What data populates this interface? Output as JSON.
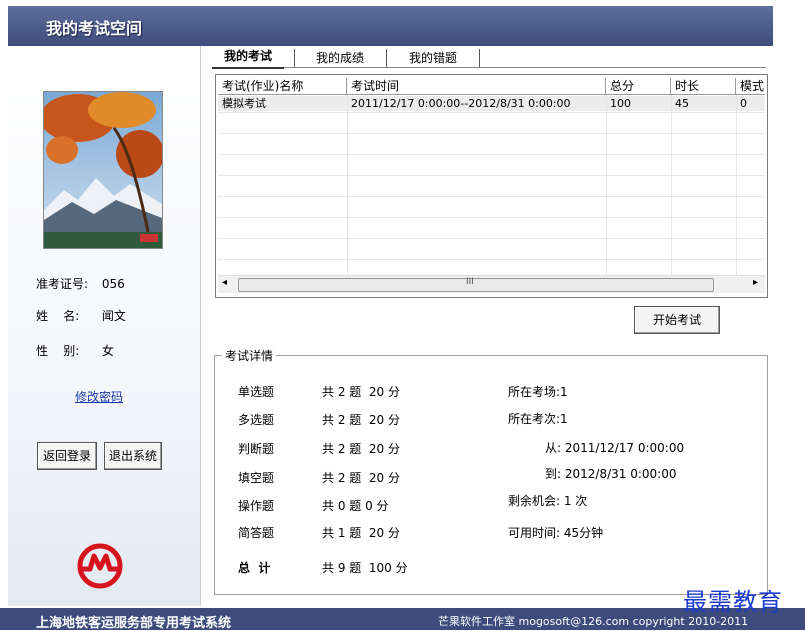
{
  "window": {
    "title": "我的考试空间"
  },
  "profile": {
    "id_label": "准考证号:",
    "id_value": "056",
    "name_label": "姓    名:",
    "name_value": "闻文",
    "gender_label": "性    别:",
    "gender_value": "女",
    "change_password": "修改密码",
    "back_login": "返回登录",
    "exit_system": "退出系统"
  },
  "tabs": [
    "我的考试",
    "我的成绩",
    "我的错题"
  ],
  "exam_table": {
    "columns": [
      "考试(作业)名称",
      "考试时间",
      "总分",
      "时长",
      "模式"
    ],
    "rows": [
      [
        "模拟考试",
        "2011/12/17 0:00:00--2012/8/31 0:00:00",
        "100",
        "45",
        "0"
      ]
    ],
    "scroll_left": "◂",
    "scroll_mid": "III",
    "scroll_right": "▸"
  },
  "start_button": "开始考试",
  "details": {
    "legend": "考试详情",
    "items": [
      {
        "type": "单选题",
        "count": "共 2 题  20 分"
      },
      {
        "type": "多选题",
        "count": "共 2 题  20 分"
      },
      {
        "type": "判断题",
        "count": "共 2 题  20 分"
      },
      {
        "type": "填空题",
        "count": "共 2 题  20 分"
      },
      {
        "type": "操作题",
        "count": "共 0 题 0 分"
      },
      {
        "type": "简答题",
        "count": "共 1 题  20 分"
      }
    ],
    "total_label": "总  计",
    "total_value": "共 9 题  100 分",
    "exam_room": "所在考场:1",
    "exam_times": "所在考次:1",
    "from": "从: 2011/12/17 0:00:00",
    "to": "到: 2012/8/31 0:00:00",
    "chances": "剩余机会: 1 次",
    "available": "可用时间: 45分钟"
  },
  "footer": {
    "system": "上海地铁客运服务部专用考试系统",
    "credit": "芒果软件工作室  mogosoft@126.com  copyright 2010-2011"
  },
  "watermark": "最需教育"
}
